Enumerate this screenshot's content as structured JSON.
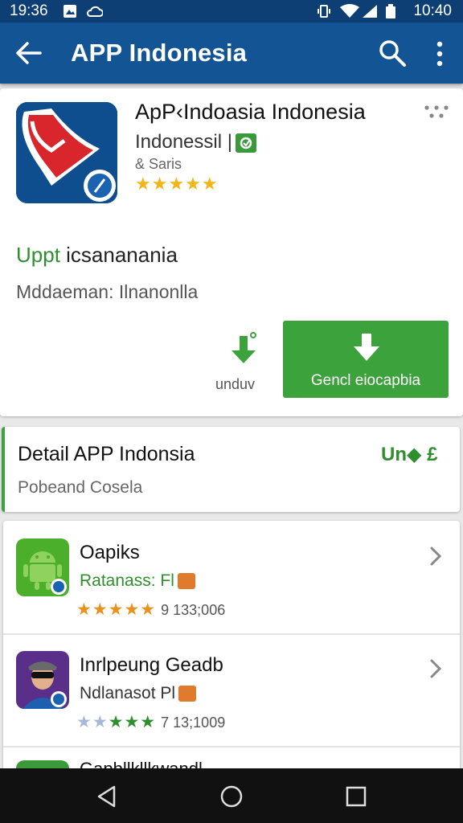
{
  "status_bar": {
    "time": "19:36",
    "clock": "10:40",
    "icons": [
      "photo-icon",
      "cloud-icon",
      "vibrate-icon",
      "wifi-icon",
      "signal-icon",
      "battery-icon"
    ]
  },
  "app_bar": {
    "title": "APP Indonesia",
    "icons": [
      "back-arrow-icon",
      "search-icon",
      "more-vert-icon"
    ]
  },
  "app_header": {
    "name": "ApP‹Indoasia Indonesia",
    "developer": "Indonessil |",
    "category": "& Saris",
    "stars": "★★★★★",
    "rating": 5
  },
  "update": {
    "prefix": "Uppt",
    "text": " icsananania"
  },
  "meta": "Mddaeman: Ilnanonlla",
  "actions": {
    "undo_label": "unduv",
    "install_label": "Gencl eiocapbia"
  },
  "detail": {
    "title": "Detail APP Indonsia",
    "subtitle": "Pobeand Cosela",
    "badge": "Un◆ £"
  },
  "list": [
    {
      "title": "Oapiks",
      "subtitle": "Ratanass: Fl",
      "stars": "★★★★★",
      "count": "9 133;006"
    },
    {
      "title": "Inrlpeung Geadb",
      "subtitle": "Ndlanasot Pl",
      "stars_grey": "★★",
      "stars_green": "★★★",
      "count": "7 13;1009"
    },
    {
      "title": "Gapbllkllkwandl"
    }
  ],
  "colors": {
    "primary": "#135594",
    "status": "#0d3f74",
    "accent_green": "#3ca23c",
    "star": "#f2b515",
    "star_orange": "#e8921c"
  }
}
